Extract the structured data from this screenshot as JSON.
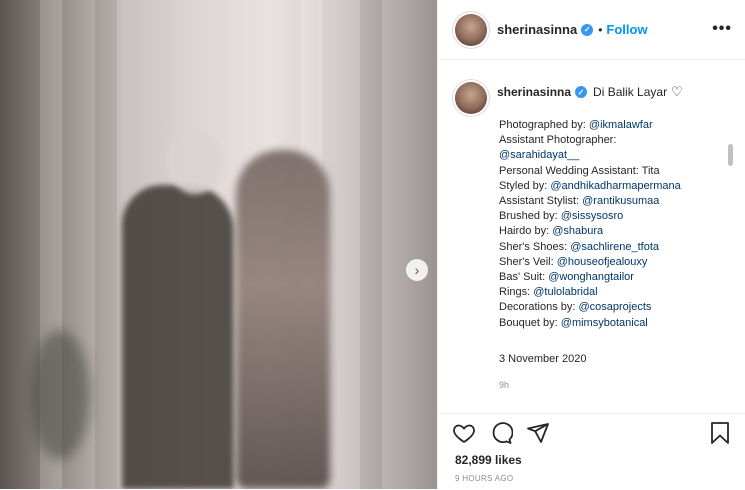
{
  "post": {
    "username": "sherinasinna",
    "follow_label": "Follow",
    "more_label": "•••",
    "caption_title": "Di Balik Layar",
    "caption_lines": [
      {
        "label": "Photographed by: ",
        "mention": "@ikmalawfar"
      },
      {
        "label": "Assistant Photographer:",
        "mention": ""
      },
      {
        "label": "",
        "mention": "@sarahidayat__"
      },
      {
        "label": "Personal Wedding Assistant: Tita",
        "mention": ""
      },
      {
        "label": "Styled by: ",
        "mention": "@andhikadharmapermana"
      },
      {
        "label": "Assistant Stylist: ",
        "mention": "@rantikusumaa"
      },
      {
        "label": "Brushed by: ",
        "mention": "@sissysosro"
      },
      {
        "label": "Hairdo by: ",
        "mention": "@shabura"
      },
      {
        "label": "Sher's Shoes: ",
        "mention": "@sachlirene_tfota"
      },
      {
        "label": "Sher's Veil: ",
        "mention": "@houseofjealouxy"
      },
      {
        "label": "Bas' Suit: ",
        "mention": "@wonghangtailor"
      },
      {
        "label": "Rings: ",
        "mention": "@tulolabridal"
      },
      {
        "label": "Decorations by: ",
        "mention": "@cosaprojects"
      },
      {
        "label": "Bouquet by: ",
        "mention": "@mimsybotanical"
      }
    ],
    "date": "3 November 2020",
    "caption_age": "9h",
    "likes": "82,899 likes",
    "timestamp": "9 HOURS AGO"
  },
  "icons": [
    "heart-icon",
    "comment-icon",
    "share-icon",
    "bookmark-icon",
    "verified-badge-icon",
    "next-arrow-icon"
  ],
  "colors": {
    "link": "#00376b",
    "follow": "#0095f6",
    "verified": "#3897f0"
  }
}
